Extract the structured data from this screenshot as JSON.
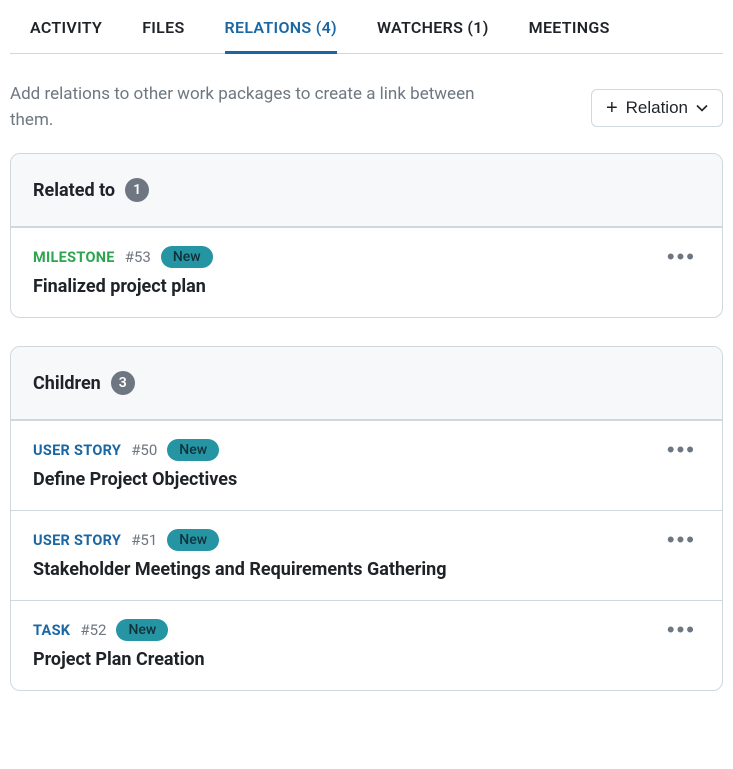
{
  "tabs": [
    {
      "label": "ACTIVITY"
    },
    {
      "label": "FILES"
    },
    {
      "label": "RELATIONS (4)"
    },
    {
      "label": "WATCHERS (1)"
    },
    {
      "label": "MEETINGS"
    }
  ],
  "help_text": "Add relations to other work packages to create a link between them.",
  "relation_button": "Relation",
  "groups": {
    "related": {
      "title": "Related to",
      "count": "1",
      "items": [
        {
          "type": "MILESTONE",
          "type_class": "milestone",
          "id": "#53",
          "status": "New",
          "title": "Finalized project plan"
        }
      ]
    },
    "children": {
      "title": "Children",
      "count": "3",
      "items": [
        {
          "type": "USER STORY",
          "type_class": "userstory",
          "id": "#50",
          "status": "New",
          "title": "Define Project Objectives"
        },
        {
          "type": "USER STORY",
          "type_class": "userstory",
          "id": "#51",
          "status": "New",
          "title": "Stakeholder Meetings and Requirements Gathering"
        },
        {
          "type": "TASK",
          "type_class": "task",
          "id": "#52",
          "status": "New",
          "title": "Project Plan Creation"
        }
      ]
    }
  }
}
